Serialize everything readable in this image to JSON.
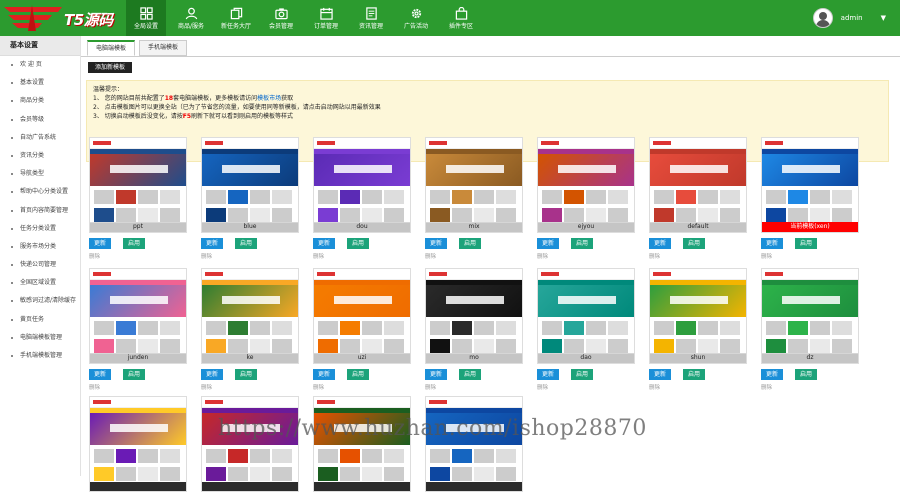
{
  "brand": {
    "logo_text": "T5源码"
  },
  "nav": [
    {
      "label": "全局设置",
      "icon": "grid-icon",
      "active": true
    },
    {
      "label": "商品/服务",
      "icon": "users-icon",
      "active": false
    },
    {
      "label": "新任务大厅",
      "icon": "copy-icon",
      "active": false
    },
    {
      "label": "会员管理",
      "icon": "camera-icon",
      "active": false
    },
    {
      "label": "订单管理",
      "icon": "calendar-icon",
      "active": false
    },
    {
      "label": "资讯管理",
      "icon": "document-icon",
      "active": false
    },
    {
      "label": "广告活动",
      "icon": "gear-icon",
      "active": false
    },
    {
      "label": "插件专区",
      "icon": "bag-icon",
      "active": false
    }
  ],
  "user": {
    "name": "admin",
    "caret": "▼"
  },
  "sidebar": {
    "heading": "基本设置",
    "items": [
      "欢 迎 页",
      "基本设置",
      "商品分类",
      "会员等级",
      "自动广告系统",
      "资讯分类",
      "导航类型",
      "帮助中心分类设置",
      "首页内容简要管理",
      "任务分类设置",
      "服务市场分类",
      "快递公司管理",
      "全国区域设置",
      "敏感词过滤/清除缓存",
      "黄页任务",
      "电脑端模板管理",
      "手机端模板管理"
    ]
  },
  "tabs": [
    {
      "label": "电脑端模板",
      "active": true
    },
    {
      "label": "手机端模板",
      "active": false
    }
  ],
  "add_button": "添加新模板",
  "notice": {
    "title": "温馨提示：",
    "lines": [
      [
        "1、 您的网站目前共配置了",
        "18",
        "套电脑端模板，更多模板请访问",
        "模板市场",
        "获取"
      ],
      [
        "2、 点击模板图片可以更换全站（已为了节省您的流量，如要使用同等新模板，请点击启动网站以用最新效果"
      ],
      [
        "3、 切换启动模板后没变化，请按",
        "F5",
        "刷新下就可以看到刚启用的模板等样式"
      ]
    ]
  },
  "buttons": {
    "update": "更新",
    "enable": "启用",
    "sub": "删除"
  },
  "templates": [
    {
      "name": "ppt",
      "theme": "#c0392b",
      "accent": "#1e4d8c",
      "current": false
    },
    {
      "name": "blue",
      "theme": "#1565c0",
      "accent": "#0c3b7a",
      "current": false
    },
    {
      "name": "dou",
      "theme": "#5b2bb5",
      "accent": "#7a3cd3",
      "current": false
    },
    {
      "name": "mix",
      "theme": "#c98a3a",
      "accent": "#8a5a22",
      "current": false
    },
    {
      "name": "ejyou",
      "theme": "#d35400",
      "accent": "#a8328b",
      "current": false
    },
    {
      "name": "default",
      "theme": "#e74c3c",
      "accent": "#c0392b",
      "current": false
    },
    {
      "name": "当前模板(xen)",
      "theme": "#1e88e5",
      "accent": "#0d47a1",
      "current": true
    },
    {
      "name": "junden",
      "theme": "#3a7bd5",
      "accent": "#f06292",
      "current": false
    },
    {
      "name": "ke",
      "theme": "#2e7d32",
      "accent": "#f9a825",
      "current": false
    },
    {
      "name": "uzi",
      "theme": "#f57c00",
      "accent": "#ef6c00",
      "current": false
    },
    {
      "name": "mo",
      "theme": "#2a2a2a",
      "accent": "#111111",
      "current": false
    },
    {
      "name": "dao",
      "theme": "#26a69a",
      "accent": "#00897b",
      "current": false
    },
    {
      "name": "shun",
      "theme": "#2e9e3e",
      "accent": "#f4b400",
      "current": false
    },
    {
      "name": "dz",
      "theme": "#2db34a",
      "accent": "#1e8e3e",
      "current": false
    },
    {
      "name": "",
      "theme": "#6a1bb5",
      "accent": "#ffca28",
      "current": false
    },
    {
      "name": "",
      "theme": "#c62828",
      "accent": "#6a1b9a",
      "current": false
    },
    {
      "name": "",
      "theme": "#e65100",
      "accent": "#1b5e20",
      "current": false
    },
    {
      "name": "",
      "theme": "#1565c0",
      "accent": "#0d47a1",
      "current": false
    }
  ],
  "watermark": "https://www.huzhan.com/ishop28870",
  "colors": {
    "topbar": "#2c9b2f",
    "update_btn": "#1a8fd8",
    "enable_btn": "#1ca37a"
  }
}
